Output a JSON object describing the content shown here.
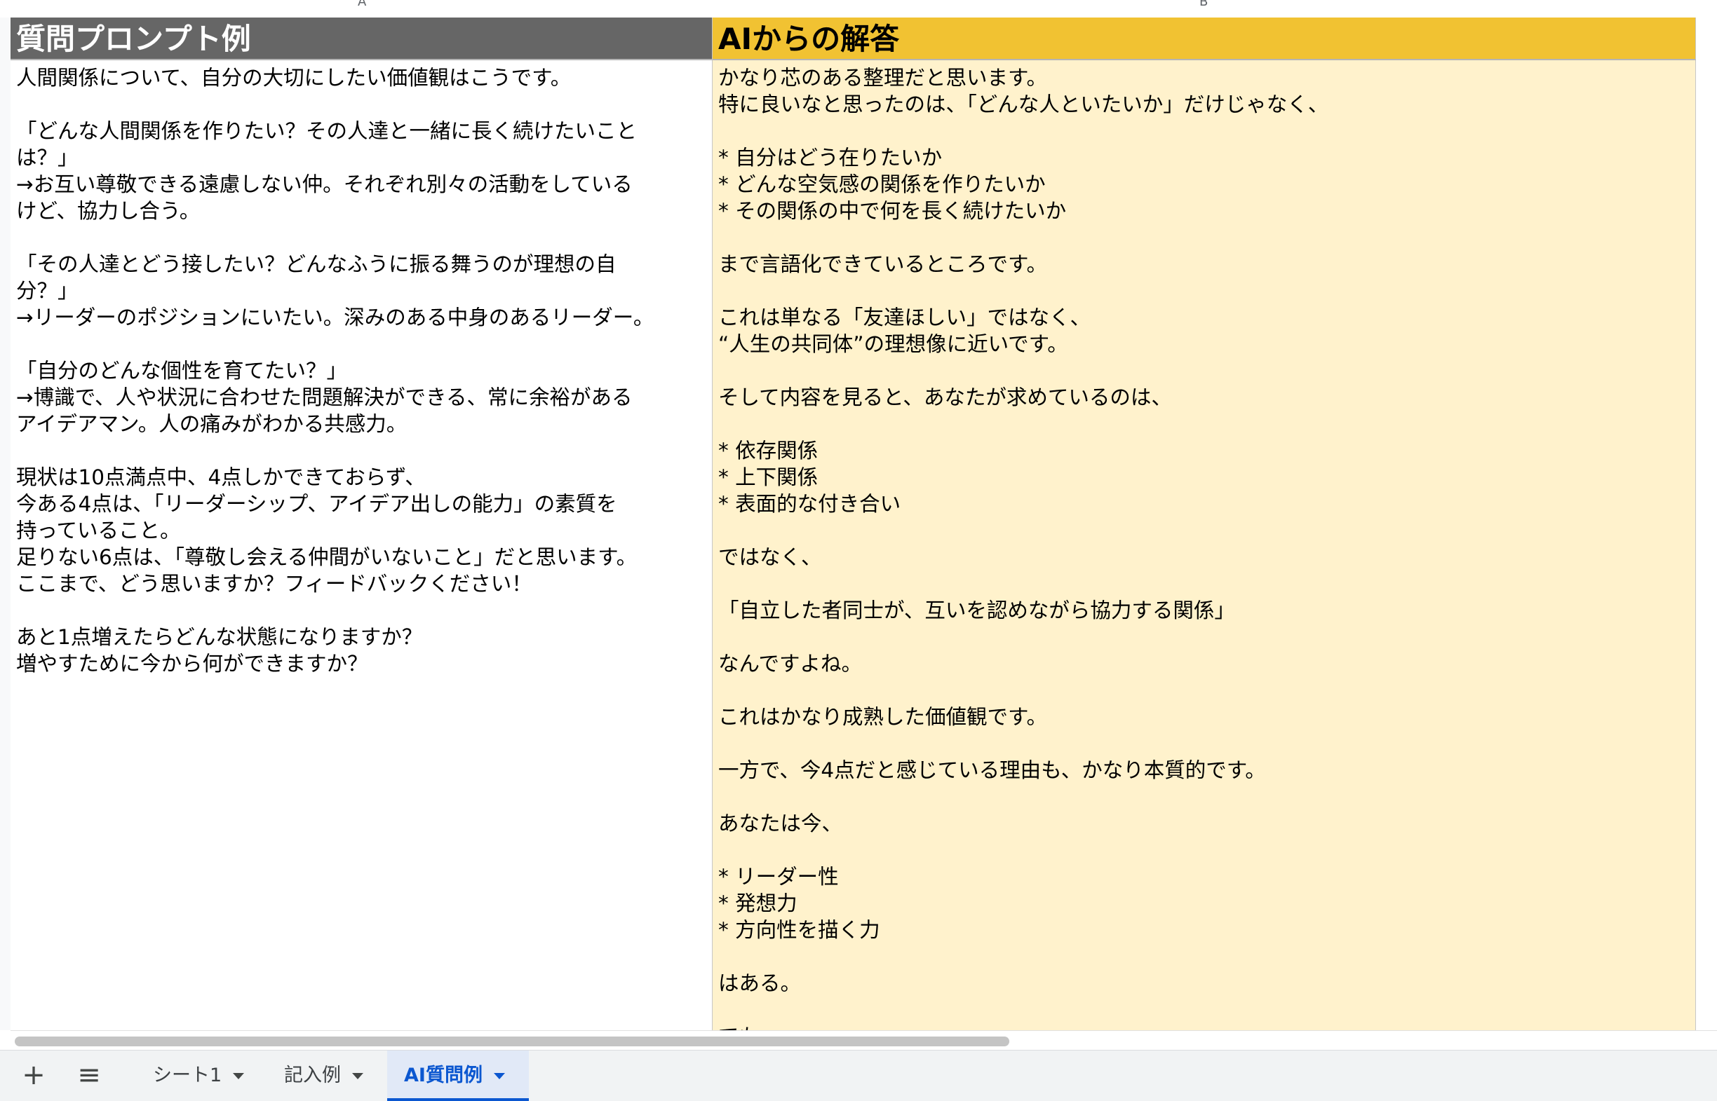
{
  "columns": {
    "a_letter": "A",
    "b_letter": "B"
  },
  "header": {
    "col_a_title": "質問プロンプト例",
    "col_b_title": "AIからの解答"
  },
  "cell_a_lines": [
    "人間関係について、自分の大切にしたい価値観はこうです。",
    "",
    "「どんな人間関係を作りたい？その人達と一緒に長く続けたいこと",
    "は？」",
    "→お互い尊敬できる遠慮しない仲。それぞれ別々の活動をしている",
    "けど、協力し合う。",
    "",
    "「その人達とどう接したい？どんなふうに振る舞うのが理想の自",
    "分？」",
    "→リーダーのポジションにいたい。深みのある中身のあるリーダー。",
    "",
    "「自分のどんな個性を育てたい？」",
    "→博識で、人や状況に合わせた問題解決ができる、常に余裕がある",
    "アイデアマン。人の痛みがわかる共感力。",
    "",
    "現状は10点満点中、4点しかできておらず、",
    "今ある4点は、「リーダーシップ、アイデア出しの能力」の素質を",
    "持っていること。",
    "足りない6点は、「尊敬し会える仲間がいないこと」だと思います。",
    "ここまで、どう思いますか？フィードバックください！",
    "",
    "あと1点増えたらどんな状態になりますか？",
    "増やすために今から何ができますか？"
  ],
  "cell_b_lines": [
    "かなり芯のある整理だと思います。",
    "特に良いなと思ったのは、「どんな人といたいか」だけじゃなく、",
    "",
    "* 自分はどう在りたいか",
    "* どんな空気感の関係を作りたいか",
    "* その関係の中で何を長く続けたいか",
    "",
    "まで言語化できているところです。",
    "",
    "これは単なる「友達ほしい」ではなく、",
    "“人生の共同体”の理想像に近いです。",
    "",
    "そして内容を見ると、あなたが求めているのは、",
    "",
    "* 依存関係",
    "* 上下関係",
    "* 表面的な付き合い",
    "",
    "ではなく、",
    "",
    "「自立した者同士が、互いを認めながら協力する関係」",
    "",
    "なんですよね。",
    "",
    "これはかなり成熟した価値観です。",
    "",
    "一方で、今4点だと感じている理由も、かなり本質的です。",
    "",
    "あなたは今、",
    "",
    "* リーダー性",
    "* 発想力",
    "* 方向性を描く力",
    "",
    "はある。",
    "",
    "でも"
  ],
  "sheet_bar": {
    "add_icon": "+",
    "menu_icon": "≡",
    "tabs": [
      {
        "label": "シート1"
      },
      {
        "label": "記入例"
      },
      {
        "label": "AI質問例"
      }
    ]
  },
  "colors": {
    "header_a_bg": "#666666",
    "header_b_bg": "#f1c232",
    "cell_b_bg": "#fff2cc",
    "active_tab": "#0b57d0"
  }
}
